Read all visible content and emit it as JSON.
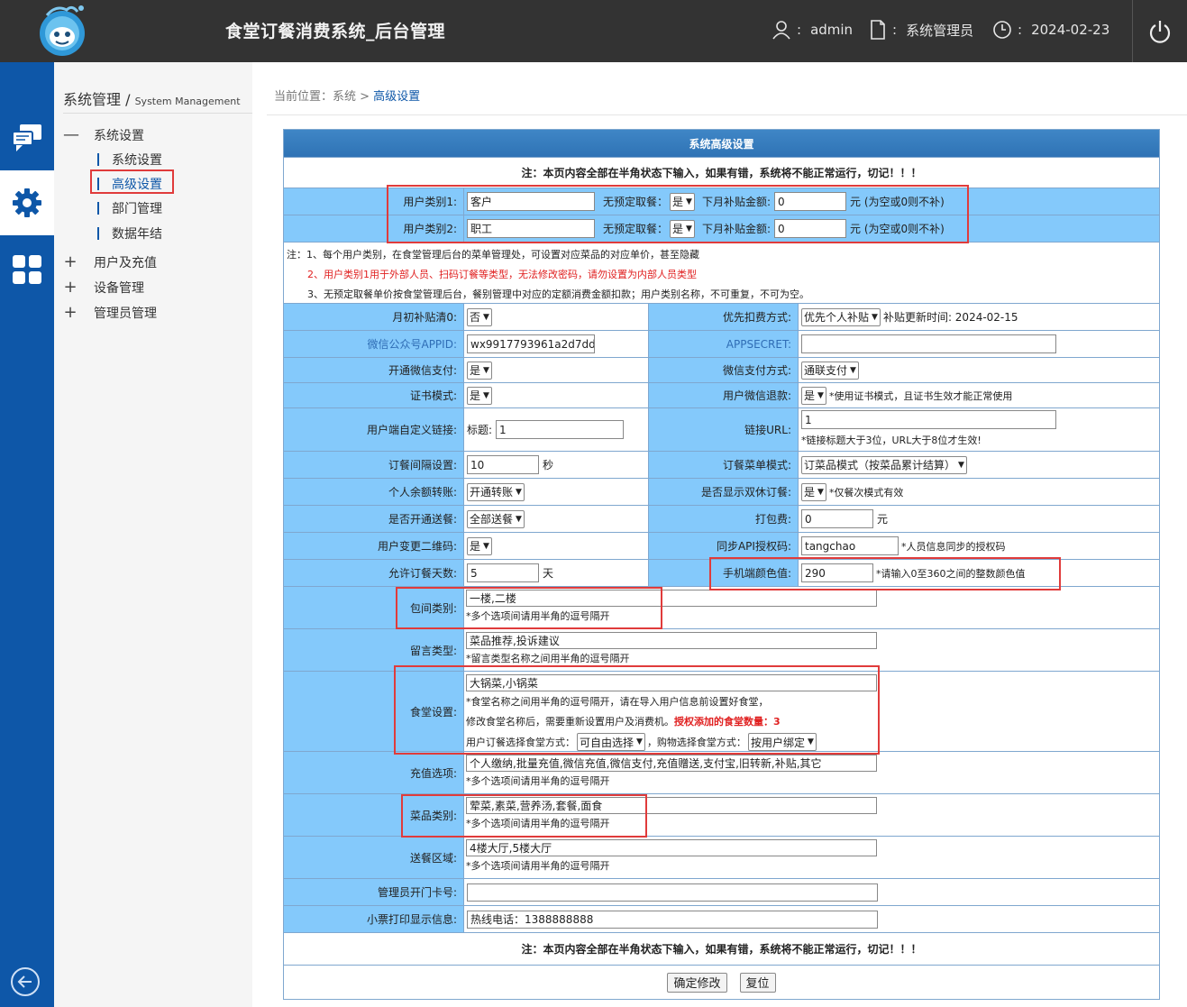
{
  "header": {
    "title": "食堂订餐消费系统_后台管理",
    "user": "admin",
    "role": "系统管理员",
    "date": "2024-02-23",
    "colon": ":"
  },
  "sidebar": {
    "title": "系统管理 / ",
    "title_en": "System Management",
    "groups": [
      {
        "sign": "—",
        "label": "系统设置"
      },
      {
        "sign": "+",
        "label": "用户及充值"
      },
      {
        "sign": "+",
        "label": "设备管理"
      },
      {
        "sign": "+",
        "label": "管理员管理"
      }
    ],
    "sub_items": [
      {
        "label": "系统设置"
      },
      {
        "label": "高级设置"
      },
      {
        "label": "部门管理"
      },
      {
        "label": "数据年结"
      }
    ]
  },
  "breadcrumb": {
    "prefix": "当前位置：系统 > ",
    "current": "高级设置"
  },
  "form": {
    "title": "系统高级设置",
    "warning": "注：本页内容全部在半角状态下输入，如果有错，系统将不能正常运行，切记！！！",
    "user_types": [
      {
        "label": "用户类别1:",
        "name": "客户",
        "no_reserve_label": "无预定取餐：",
        "no_reserve": "是",
        "subsidy_label": "下月补贴金额:",
        "subsidy": "0",
        "subsidy_unit": "元 (为空或0则不补)"
      },
      {
        "label": "用户类别2:",
        "name": "职工",
        "no_reserve_label": "无预定取餐：",
        "no_reserve": "是",
        "subsidy_label": "下月补贴金额:",
        "subsidy": "0",
        "subsidy_unit": "元 (为空或0则不补)"
      }
    ],
    "notes": {
      "n1": "注：1、每个用户类别，在食堂管理后台的菜单管理处，可设置对应菜品的对应单价，甚至隐藏",
      "n2": "2、用户类别1用于外部人员、扫码订餐等类型，无法修改密码，请勿设置为内部人员类型",
      "n3": "3、无预定取餐单价按食堂管理后台，餐别管理中对应的定额消费金额扣款；用户类别名称，不可重复，不可为空。"
    },
    "month_clear_label": "月初补贴清0:",
    "month_clear": "否",
    "deduct_label": "优先扣费方式:",
    "deduct": "优先个人补贴",
    "subsidy_update": "补贴更新时间: 2024-02-15",
    "appid_label": "微信公众号APPID:",
    "appid": "wx9917793961a2d7dd",
    "secret_label": "APPSECRET:",
    "secret": "",
    "wxpay_label": "开通微信支付:",
    "wxpay": "是",
    "wxpay_mode_label": "微信支付方式:",
    "wxpay_mode": "通联支付",
    "cert_label": "证书模式:",
    "cert": "是",
    "refund_label": "用户微信退款:",
    "refund": "是",
    "refund_note": "*使用证书模式，且证书生效才能正常使用",
    "link_label": "用户端自定义链接:",
    "link_title_label": "标题:",
    "link_title": "1",
    "url_label": "链接URL:",
    "url": "1",
    "url_note": "*链接标题大于3位，URL大于8位才生效!",
    "interval_label": "订餐间隔设置:",
    "interval": "10",
    "interval_unit": "秒",
    "menu_mode_label": "订餐菜单模式:",
    "menu_mode": "订菜品模式（按菜品累计结算）",
    "transfer_label": "个人余额转账:",
    "transfer": "开通转账",
    "double_label": "是否显示双休订餐:",
    "double": "是",
    "double_note": "*仅餐次模式有效",
    "delivery_label": "是否开通送餐:",
    "delivery": "全部送餐",
    "pack_label": "打包费:",
    "pack": "0",
    "pack_unit": "元",
    "qrcode_label": "用户变更二维码:",
    "qrcode": "是",
    "api_label": "同步API授权码:",
    "api": "tangchao",
    "api_note": "*人员信息同步的授权码",
    "days_label": "允许订餐天数:",
    "days": "5",
    "days_unit": "天",
    "color_label": "手机端颜色值:",
    "color": "290",
    "color_note": "*请输入0至360之间的整数颜色值",
    "room_label": "包间类别:",
    "room": "一楼,二楼",
    "room_note": "*多个选项间请用半角的逗号隔开",
    "msg_label": "留言类型:",
    "msg": "菜品推荐,投诉建议",
    "msg_note": "*留言类型名称之间用半角的逗号隔开",
    "canteen_label": "食堂设置:",
    "canteen": "大锅菜,小锅菜",
    "canteen_note1": "*食堂名称之间用半角的逗号隔开，请在导入用户信息前设置好食堂，",
    "canteen_note2": "修改食堂名称后，需要重新设置用户及消费机。",
    "canteen_auth": "授权添加的食堂数量：3",
    "canteen_order_label": "用户订餐选择食堂方式：",
    "canteen_order": "可自由选择",
    "canteen_shop_label": "，购物选择食堂方式：",
    "canteen_shop": "按用户绑定",
    "recharge_label": "充值选项:",
    "recharge": "个人缴纳,批量充值,微信充值,微信支付,充值赠送,支付宝,旧转新,补贴,其它",
    "recharge_note": "*多个选项间请用半角的逗号隔开",
    "dish_label": "菜品类别:",
    "dish": "荤菜,素菜,营养汤,套餐,面食",
    "dish_note": "*多个选项间请用半角的逗号隔开",
    "area_label": "送餐区域:",
    "area": "4楼大厅,5楼大厅",
    "area_note": "*多个选项间请用半角的逗号隔开",
    "door_label": "管理员开门卡号:",
    "door": "",
    "receipt_label": "小票打印显示信息:",
    "receipt": "热线电话：1388888888",
    "confirm": "确定修改",
    "reset": "复位"
  }
}
